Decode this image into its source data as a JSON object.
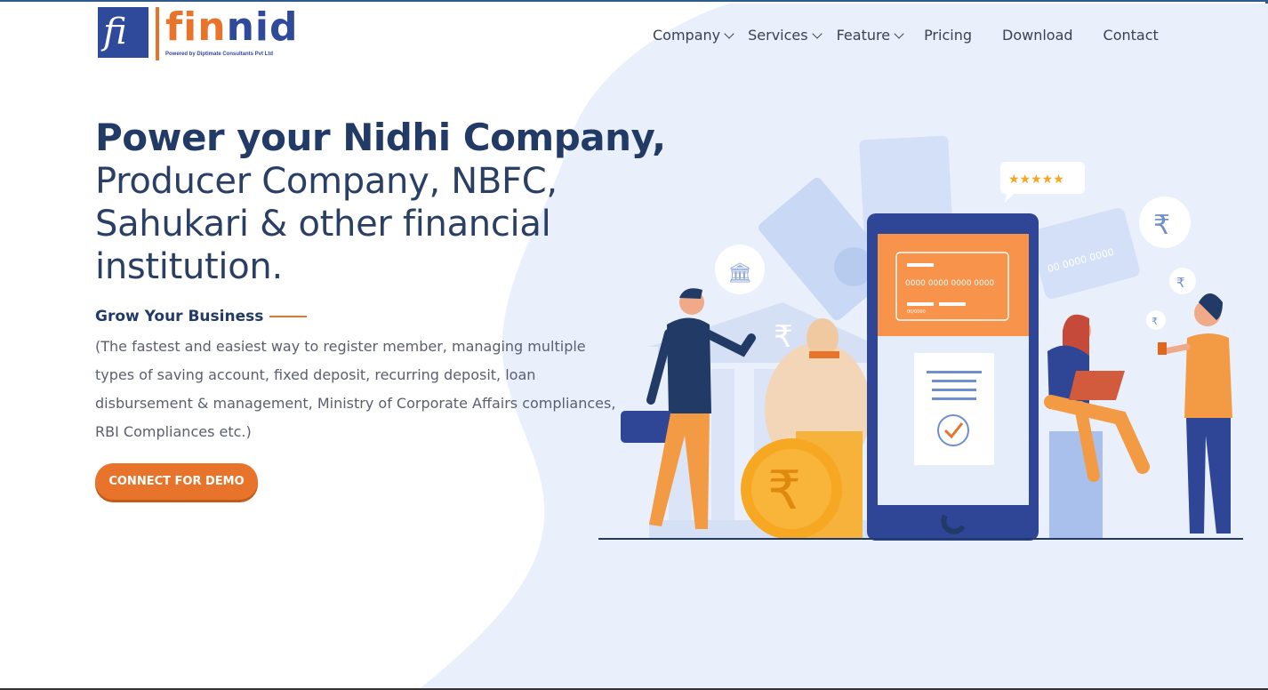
{
  "logo": {
    "mark_letters": "fi",
    "word_fin": "fin",
    "word_nid": "nid",
    "tagline": "Powered by Diptimate Consultants Pvt Ltd"
  },
  "nav": {
    "items": [
      {
        "label": "Company",
        "dropdown": true
      },
      {
        "label": "Services",
        "dropdown": true
      },
      {
        "label": "Feature",
        "dropdown": true
      },
      {
        "label": "Pricing",
        "dropdown": false
      },
      {
        "label": "Download",
        "dropdown": false
      },
      {
        "label": "Contact",
        "dropdown": false
      }
    ]
  },
  "hero": {
    "title_bold": "Power your Nidhi Company,",
    "title_line2": "Producer Company, NBFC,",
    "title_line3": "Sahukari & other financial",
    "title_line4": "institution.",
    "subtitle": "Grow Your Business",
    "description": "(The fastest and easiest way to register member, managing multiple types of saving account, fixed deposit, recurring deposit, loan disbursement & management, Ministry of Corporate Affairs compliances, RBI Compliances etc.)",
    "cta_label": "CONNECT FOR DEMO"
  },
  "illustration": {
    "card_number": "0000 0000 0000 0000",
    "card_small": "00/0000",
    "back_card_number": "00 0000 0000",
    "rating_stars": 5,
    "currency_symbol": "₹"
  },
  "colors": {
    "accent": "#e8732a",
    "brand_blue": "#2f4a9a",
    "title": "#223a66",
    "blob": "#eaf0fb"
  }
}
